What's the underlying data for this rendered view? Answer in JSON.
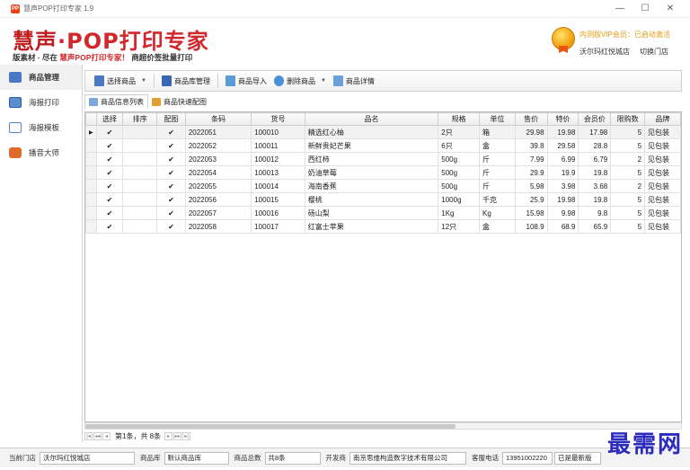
{
  "window": {
    "title": "慧声POP打印专家 1.9",
    "minimize": "—",
    "maximize": "☐",
    "close": "✕",
    "app_icon_text": "PP"
  },
  "banner": {
    "logo_brand": "慧声",
    "logo_dot": "·",
    "logo_rest": "POP打印专家",
    "tagline_prefix": "版素材 · 尽在 ",
    "tagline_highlight": "慧声POP打印专家！",
    "tagline_suffix": " 商超价签批量打印",
    "vip_text": "内测版VIP会员：已启动激活",
    "store_name": "沃尔玛红悦城店",
    "switch_store": "切换门店"
  },
  "sidebar": {
    "items": [
      {
        "label": "商品管理",
        "icon": "goods-icon",
        "active": true
      },
      {
        "label": "海报打印",
        "icon": "poster-print-icon",
        "active": false
      },
      {
        "label": "海报模板",
        "icon": "poster-template-icon",
        "active": false
      },
      {
        "label": "播音大师",
        "icon": "broadcast-icon",
        "active": false
      }
    ]
  },
  "toolbar": {
    "select_goods": "选择商品",
    "goods_library": "商品库管理",
    "import_goods": "商品导入",
    "delete_goods": "删除商品",
    "goods_detail": "商品详情"
  },
  "subtabs": {
    "list": "商品信息列表",
    "quick": "商品快速配图"
  },
  "table": {
    "headers": [
      "选择",
      "排序",
      "配图",
      "条码",
      "货号",
      "品名",
      "规格",
      "单位",
      "售价",
      "特价",
      "会员价",
      "限购数",
      "品牌"
    ],
    "rows": [
      [
        "✔",
        "",
        "✔",
        "2022051",
        "100010",
        "精选红心柚",
        "2只",
        "箱",
        "29.98",
        "19.98",
        "17.98",
        "5",
        "见包装"
      ],
      [
        "✔",
        "",
        "✔",
        "2022052",
        "100011",
        "新鲜贵妃芒果",
        "6只",
        "盒",
        "39.8",
        "29.58",
        "28.8",
        "5",
        "见包装"
      ],
      [
        "✔",
        "",
        "✔",
        "2022053",
        "100012",
        "西红柿",
        "500g",
        "斤",
        "7.99",
        "6.99",
        "6.79",
        "2",
        "见包装"
      ],
      [
        "✔",
        "",
        "✔",
        "2022054",
        "100013",
        "奶油草莓",
        "500g",
        "斤",
        "29.9",
        "19.9",
        "19.8",
        "5",
        "见包装"
      ],
      [
        "✔",
        "",
        "✔",
        "2022055",
        "100014",
        "海南香蕉",
        "500g",
        "斤",
        "5.98",
        "3.98",
        "3.68",
        "2",
        "见包装"
      ],
      [
        "✔",
        "",
        "✔",
        "2022056",
        "100015",
        "樱桃",
        "1000g",
        "千克",
        "25.9",
        "19.98",
        "19.8",
        "5",
        "见包装"
      ],
      [
        "✔",
        "",
        "✔",
        "2022057",
        "100016",
        "砀山梨",
        "1Kg",
        "Kg",
        "15.98",
        "9.98",
        "9.8",
        "5",
        "见包装"
      ],
      [
        "✔",
        "",
        "✔",
        "2022058",
        "100017",
        "红富士苹果",
        "12只",
        "盒",
        "108.9",
        "68.9",
        "65.9",
        "5",
        "见包装"
      ]
    ]
  },
  "pager": {
    "first": "|◂",
    "prev_page": "◂◂",
    "prev": "◂",
    "page_info": "第1条，共 8条",
    "next": "▸",
    "next_page": "▸▸",
    "last": "▸|"
  },
  "statusbar": {
    "current_store_label": "当前门店",
    "current_store": "沃尔玛红悦城店",
    "goods_lib_label": "商品库",
    "goods_lib": "默认商品库",
    "total_label": "商品总数",
    "total": "共8条",
    "developer_label": "开发商",
    "developer": "南京思维构造数字技术有限公司",
    "service_label": "客服电话",
    "service_phone": "13951002220",
    "version_status": "已是最新版"
  },
  "watermark": "最需网"
}
